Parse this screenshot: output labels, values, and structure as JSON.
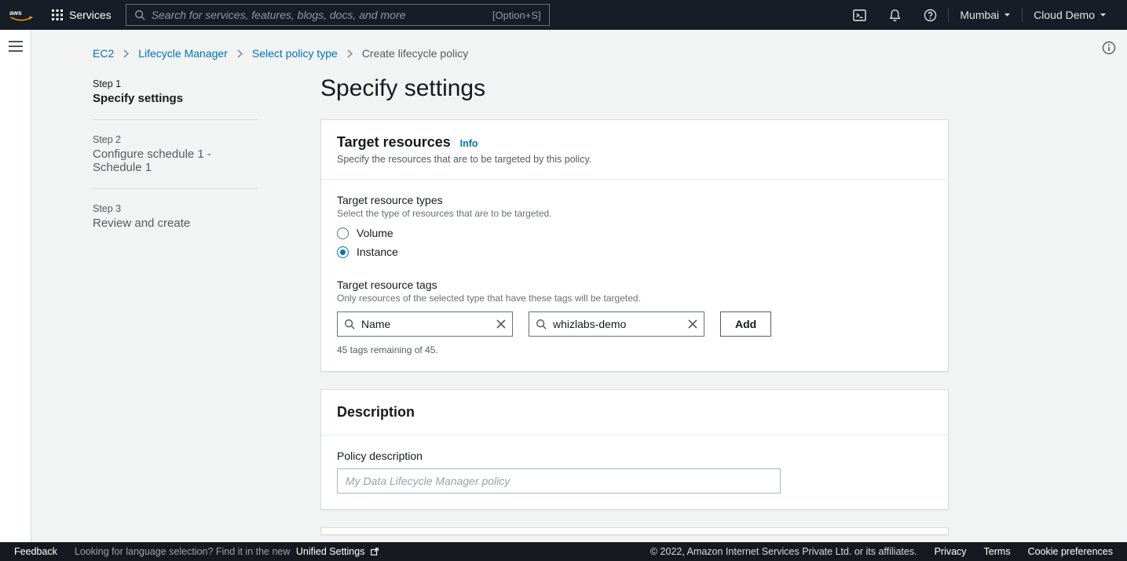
{
  "topnav": {
    "services_label": "Services",
    "search_placeholder": "Search for services, features, blogs, docs, and more",
    "search_hint": "[Option+S]",
    "region": "Mumbai",
    "account": "Cloud Demo"
  },
  "breadcrumbs": {
    "items": [
      "EC2",
      "Lifecycle Manager",
      "Select policy type",
      "Create lifecycle policy"
    ]
  },
  "steps": [
    {
      "label": "Step 1",
      "title": "Specify settings",
      "active": true
    },
    {
      "label": "Step 2",
      "title": "Configure schedule 1 - Schedule 1",
      "active": false
    },
    {
      "label": "Step 3",
      "title": "Review and create",
      "active": false
    }
  ],
  "page_heading": "Specify settings",
  "target_panel": {
    "title": "Target resources",
    "info": "Info",
    "subtitle": "Specify the resources that are to be targeted by this policy.",
    "types_label": "Target resource types",
    "types_desc": "Select the type of resources that are to be targeted.",
    "radio_volume": "Volume",
    "radio_instance": "Instance",
    "tags_label": "Target resource tags",
    "tags_desc": "Only resources of the selected type that have these tags will be targeted.",
    "tag_key_value": "Name",
    "tag_value_value": "whizlabs-demo",
    "add_button": "Add",
    "remaining": "45 tags remaining of 45."
  },
  "description_panel": {
    "title": "Description",
    "field_label": "Policy description",
    "placeholder": "My Data Lifecycle Manager policy"
  },
  "footer": {
    "feedback": "Feedback",
    "language_prompt": "Looking for language selection? Find it in the new",
    "unified": "Unified Settings",
    "copyright": "© 2022, Amazon Internet Services Private Ltd. or its affiliates.",
    "privacy": "Privacy",
    "terms": "Terms",
    "cookies": "Cookie preferences"
  }
}
